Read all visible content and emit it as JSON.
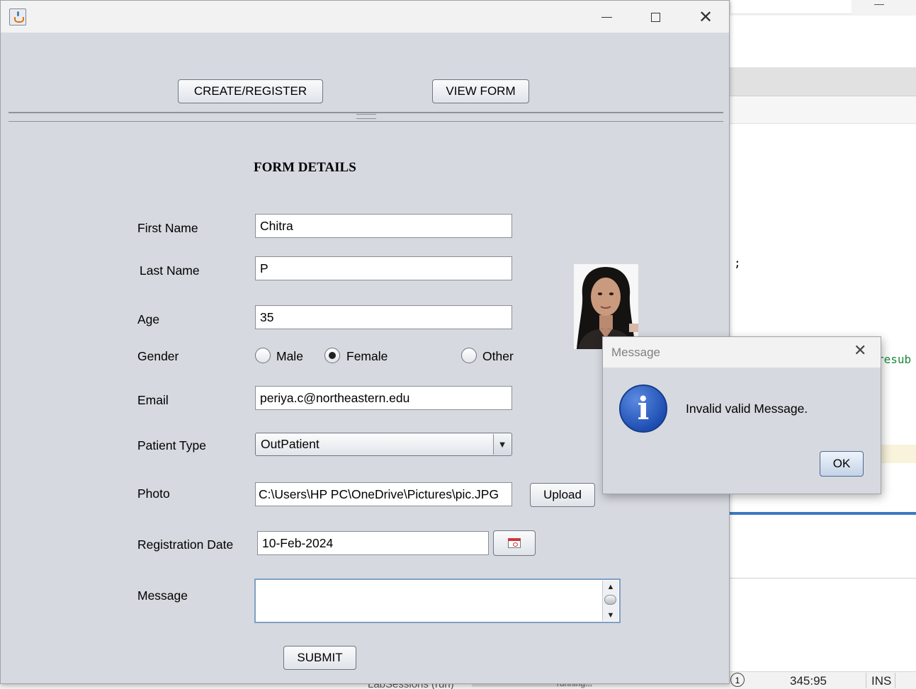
{
  "ide": {
    "code_semicolon": ";",
    "code_fragment": "resub",
    "status": {
      "notification_count": "1",
      "position": "345:95",
      "insert_mode": "INS",
      "task_label": "LabSessions (run)",
      "progress_text": "running..."
    }
  },
  "window": {
    "toolbar": {
      "create_register_label": "CREATE/REGISTER",
      "view_form_label": "VIEW FORM"
    },
    "form": {
      "heading": "FORM DETAILS",
      "first_name_label": "First Name",
      "first_name_value": "Chitra",
      "last_name_label": "Last Name",
      "last_name_value": "P",
      "age_label": "Age",
      "age_value": "35",
      "gender_label": "Gender",
      "gender_options": [
        "Male",
        "Female",
        "Other"
      ],
      "gender_selected": "Female",
      "email_label": "Email",
      "email_value": "periya.c@northeastern.edu",
      "patient_type_label": "Patient Type",
      "patient_type_value": "OutPatient",
      "photo_label": "Photo",
      "photo_path": "C:\\Users\\HP PC\\OneDrive\\Pictures\\pic.JPG",
      "upload_label": "Upload",
      "registration_date_label": "Registration Date",
      "registration_date_value": "10-Feb-2024",
      "message_label": "Message",
      "message_value": "",
      "submit_label": "SUBMIT"
    }
  },
  "dialog": {
    "title": "Message",
    "text": "Invalid valid Message.",
    "ok_label": "OK",
    "icon": "info-icon"
  },
  "colors": {
    "frame_background": "#d6d9df",
    "titlebar": "#f2f2f2",
    "info_icon_blue": "#1f4fb3",
    "textarea_focus_border": "#7f9fc6"
  }
}
